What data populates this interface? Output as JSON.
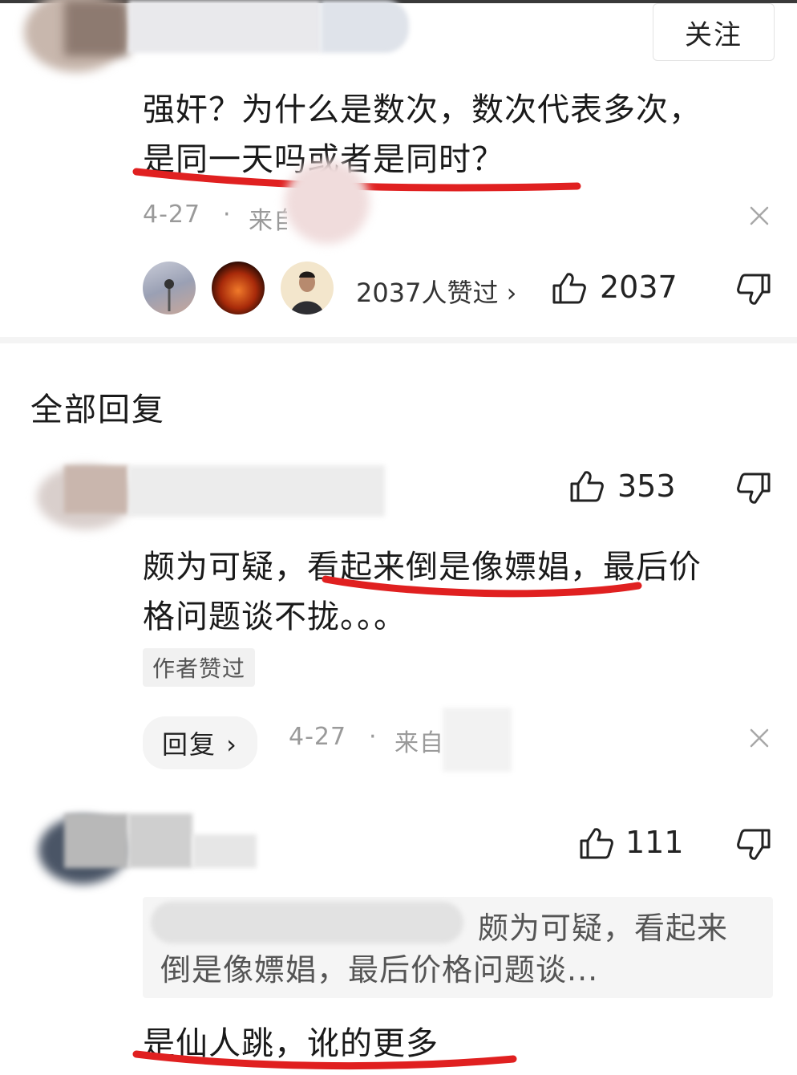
{
  "header": {
    "follow_label": "关注"
  },
  "main_comment": {
    "line1": "强奸？为什么是数次，数次代表多次，",
    "line2": "是同一天吗或者是同时？",
    "date": "4-27",
    "dot": "·",
    "source_prefix": "来自",
    "liked_by_label": "2037人赞过 ›",
    "like_count": "2037"
  },
  "replies_section": {
    "title": "全部回复"
  },
  "reply1": {
    "like_count": "353",
    "line1_a": "颇为可疑，",
    "line1_b": "看起来倒是像嫖娼，",
    "line1_c": "最后价",
    "line2": "格问题谈不拢。。。",
    "badge": "作者赞过",
    "reply_label": "回复 ›",
    "date": "4-27",
    "dot": "·",
    "source_prefix": "来自"
  },
  "reply2": {
    "like_count": "111",
    "quote_line1": "颇为可疑，看起来",
    "quote_line2": "倒是像嫖娼，最后价格问题谈...",
    "text": "是仙人跳，讹的更多"
  },
  "colors": {
    "annotation_red": "#e02020",
    "meta_gray": "#9a9a9a",
    "divider": "#f4f4f4"
  },
  "icons": [
    "thumbs-up-icon",
    "thumbs-down-icon",
    "close-icon"
  ]
}
